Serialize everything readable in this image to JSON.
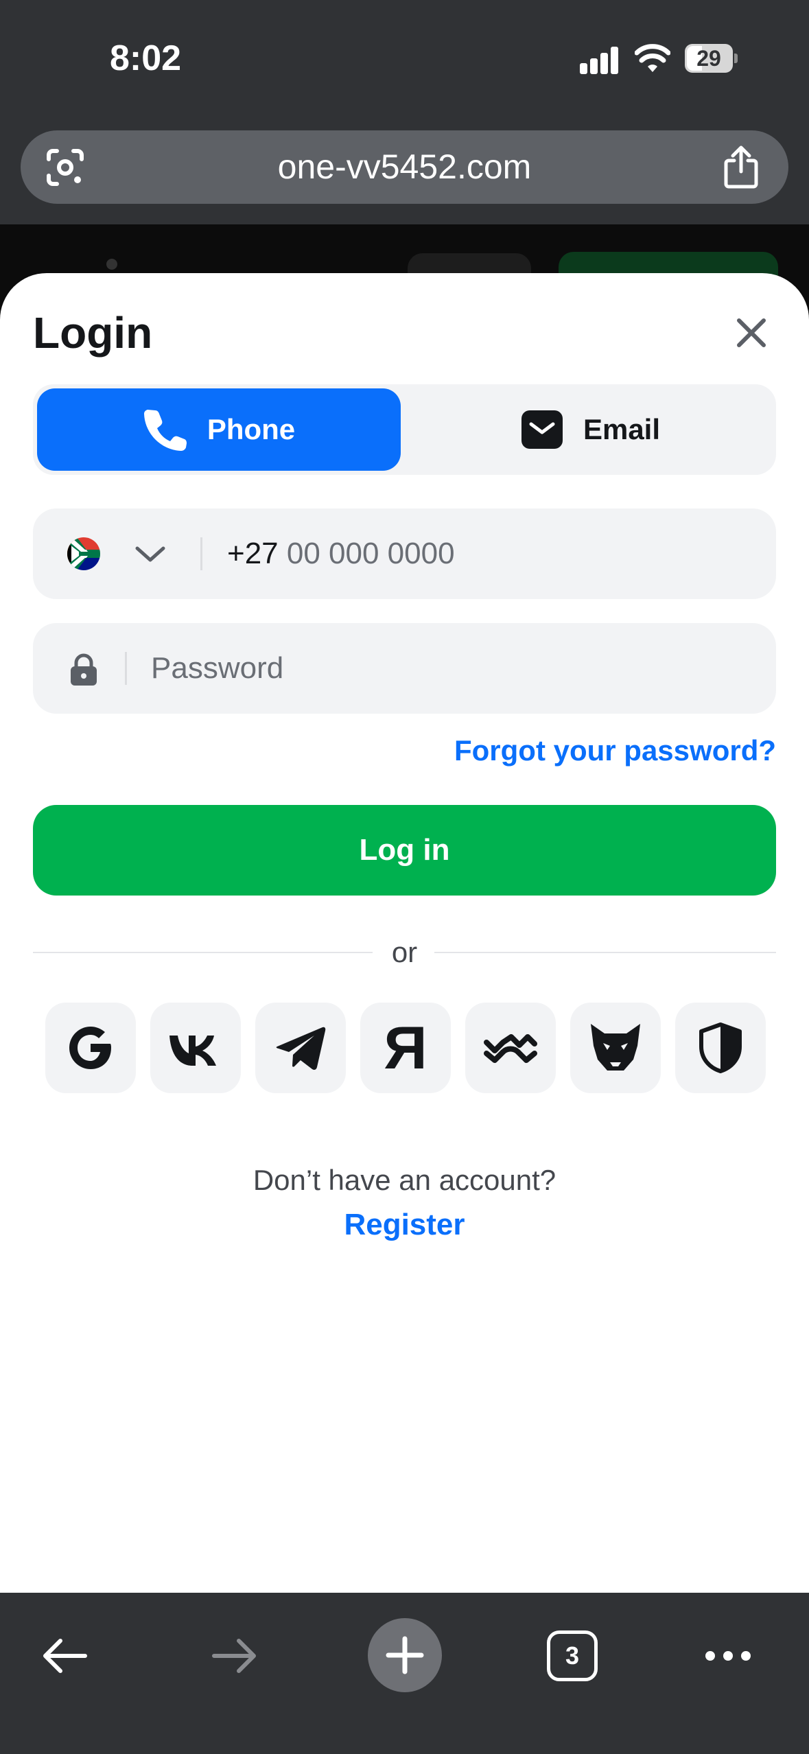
{
  "status_bar": {
    "time": "8:02",
    "battery": "29"
  },
  "browser": {
    "url": "one-vv5452.com",
    "tab_count": "3"
  },
  "login": {
    "title": "Login",
    "tabs": [
      {
        "label": "Phone",
        "active": true
      },
      {
        "label": "Email",
        "active": false
      }
    ],
    "phone": {
      "country_code": "+27",
      "placeholder": "00 000 0000"
    },
    "password": {
      "placeholder": "Password"
    },
    "forgot_label": "Forgot your password?",
    "login_label": "Log in",
    "or_label": "or",
    "social_providers": [
      "google-icon",
      "vk-icon",
      "telegram-icon",
      "yandex-icon",
      "walletconnect-icon",
      "metamask-fox-icon",
      "shield-icon"
    ],
    "yandex_glyph": "Я",
    "no_account_label": "Don’t have an account?",
    "register_label": "Register"
  },
  "colors": {
    "primary_blue": "#0a6ffb",
    "login_green": "#00b14f",
    "field_bg": "#f2f3f5",
    "chrome_dark": "#303235"
  }
}
